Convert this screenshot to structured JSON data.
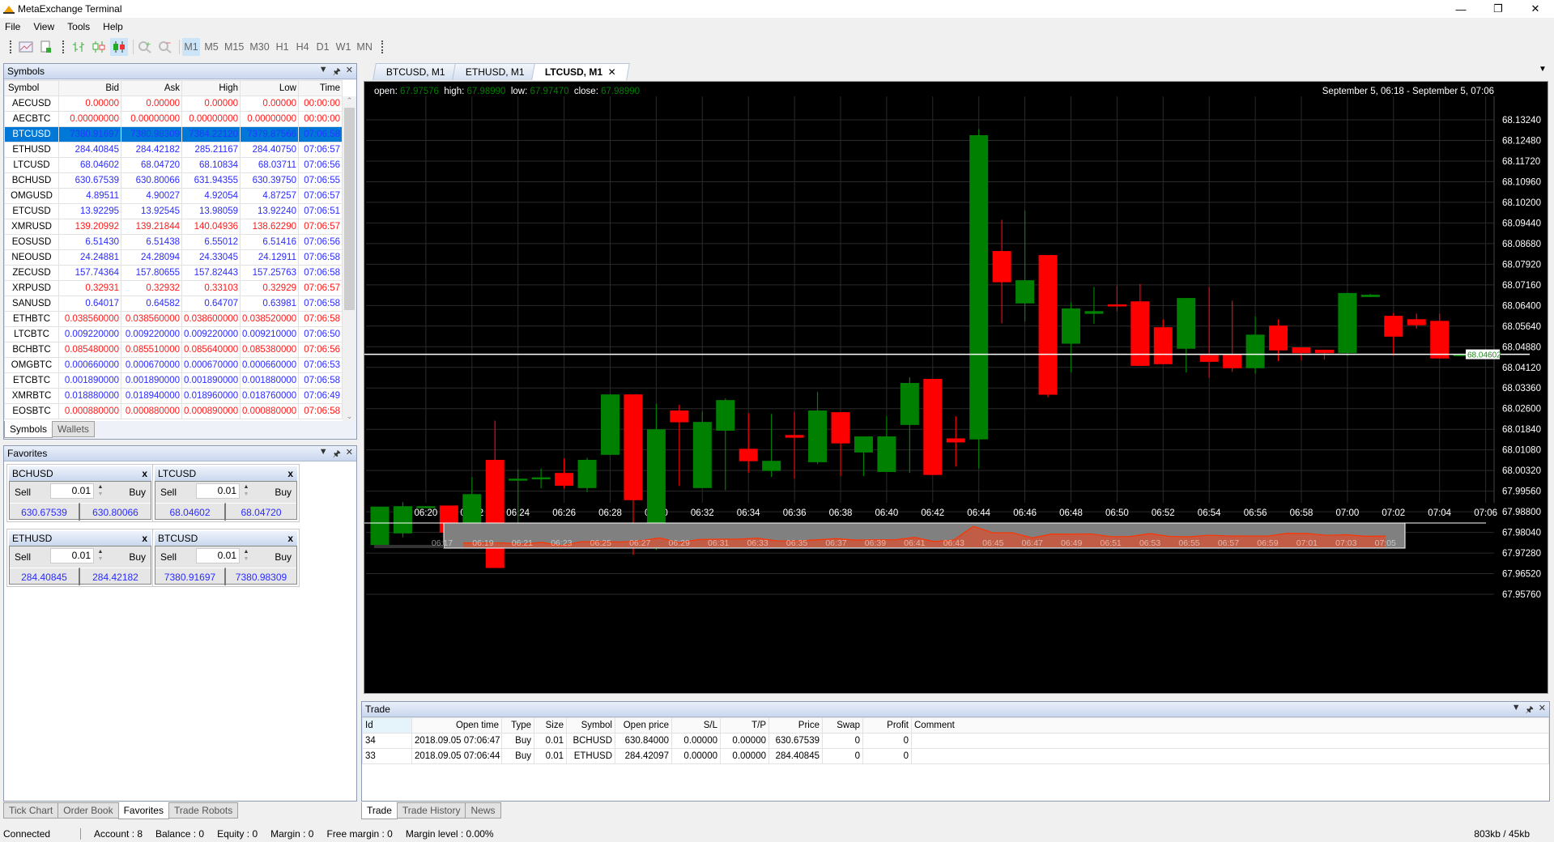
{
  "window": {
    "title": "MetaExchange Terminal"
  },
  "menu": [
    "File",
    "View",
    "Tools",
    "Help"
  ],
  "toolbar": {
    "timeframes": [
      "M1",
      "M5",
      "M15",
      "M30",
      "H1",
      "H4",
      "D1",
      "W1",
      "MN"
    ],
    "selected": "M1"
  },
  "symbols_panel": {
    "title": "Symbols",
    "columns": [
      "Symbol",
      "Bid",
      "Ask",
      "High",
      "Low",
      "Time"
    ],
    "rows": [
      [
        "AECUSD",
        "0.00000",
        "0.00000",
        "0.00000",
        "0.00000",
        "00:00:00",
        "down"
      ],
      [
        "AECBTC",
        "0.00000000",
        "0.00000000",
        "0.00000000",
        "0.00000000",
        "00:00:00",
        "down"
      ],
      [
        "BTCUSD",
        "7380.91697",
        "7380.98309",
        "7384.22120",
        "7379.87566",
        "07:06:58",
        "sel"
      ],
      [
        "ETHUSD",
        "284.40845",
        "284.42182",
        "285.21167",
        "284.40750",
        "07:06:57",
        "up"
      ],
      [
        "LTCUSD",
        "68.04602",
        "68.04720",
        "68.10834",
        "68.03711",
        "07:06:56",
        "up"
      ],
      [
        "BCHUSD",
        "630.67539",
        "630.80066",
        "631.94355",
        "630.39750",
        "07:06:55",
        "up"
      ],
      [
        "OMGUSD",
        "4.89511",
        "4.90027",
        "4.92054",
        "4.87257",
        "07:06:57",
        "up"
      ],
      [
        "ETCUSD",
        "13.92295",
        "13.92545",
        "13.98059",
        "13.92240",
        "07:06:51",
        "up"
      ],
      [
        "XMRUSD",
        "139.20992",
        "139.21844",
        "140.04936",
        "138.62290",
        "07:06:57",
        "down"
      ],
      [
        "EOSUSD",
        "6.51430",
        "6.51438",
        "6.55012",
        "6.51416",
        "07:06:56",
        "up"
      ],
      [
        "NEOUSD",
        "24.24881",
        "24.28094",
        "24.33045",
        "24.12911",
        "07:06:58",
        "up"
      ],
      [
        "ZECUSD",
        "157.74364",
        "157.80655",
        "157.82443",
        "157.25763",
        "07:06:58",
        "up"
      ],
      [
        "XRPUSD",
        "0.32931",
        "0.32932",
        "0.33103",
        "0.32929",
        "07:06:57",
        "down"
      ],
      [
        "SANUSD",
        "0.64017",
        "0.64582",
        "0.64707",
        "0.63981",
        "07:06:58",
        "up"
      ],
      [
        "ETHBTC",
        "0.038560000",
        "0.038560000",
        "0.038600000",
        "0.038520000",
        "07:06:58",
        "down"
      ],
      [
        "LTCBTC",
        "0.009220000",
        "0.009220000",
        "0.009220000",
        "0.009210000",
        "07:06:50",
        "up"
      ],
      [
        "BCHBTC",
        "0.085480000",
        "0.085510000",
        "0.085640000",
        "0.085380000",
        "07:06:56",
        "down"
      ],
      [
        "OMGBTC",
        "0.000660000",
        "0.000670000",
        "0.000670000",
        "0.000660000",
        "07:06:53",
        "up"
      ],
      [
        "ETCBTC",
        "0.001890000",
        "0.001890000",
        "0.001890000",
        "0.001880000",
        "07:06:58",
        "up"
      ],
      [
        "XMRBTC",
        "0.018880000",
        "0.018940000",
        "0.018960000",
        "0.018760000",
        "07:06:49",
        "up"
      ],
      [
        "EOSBTC",
        "0.000880000",
        "0.000880000",
        "0.000890000",
        "0.000880000",
        "07:06:58",
        "down"
      ]
    ],
    "tabs": [
      "Symbols",
      "Wallets"
    ]
  },
  "favorites_panel": {
    "title": "Favorites",
    "sell_label": "Sell",
    "buy_label": "Buy",
    "cards": [
      {
        "symbol": "BCHUSD",
        "qty": "0.01",
        "bid": "630.67539",
        "ask": "630.80066"
      },
      {
        "symbol": "LTCUSD",
        "qty": "0.01",
        "bid": "68.04602",
        "ask": "68.04720"
      },
      {
        "symbol": "ETHUSD",
        "qty": "0.01",
        "bid": "284.40845",
        "ask": "284.42182"
      },
      {
        "symbol": "BTCUSD",
        "qty": "0.01",
        "bid": "7380.91697",
        "ask": "7380.98309"
      }
    ]
  },
  "left_tabs": [
    "Tick Chart",
    "Order Book",
    "Favorites",
    "Trade Robots"
  ],
  "left_tabs_active": "Favorites",
  "chart_tabs": [
    "BTCUSD, M1",
    "ETHUSD, M1",
    "LTCUSD, M1"
  ],
  "chart_tab_active": "LTCUSD, M1",
  "chart": {
    "ohlc": {
      "open_label": "open:",
      "open": "67.97576",
      "high_label": "high:",
      "high": "67.98990",
      "low_label": "low:",
      "low": "67.97470",
      "close_label": "close:",
      "close": "67.98990"
    },
    "range": "September 5, 06:18 - September 5, 07:06",
    "current_price": "68.04602",
    "colors": {
      "up": "#008000",
      "down": "#ff0000",
      "nav_fill": "#c8593f",
      "nav_line": "#ff3300"
    }
  },
  "chart_data": {
    "type": "candlestick",
    "title": "LTCUSD, M1",
    "price_ticks": [
      "68.13240",
      "68.12480",
      "68.11720",
      "68.10960",
      "68.10200",
      "68.09440",
      "68.08680",
      "68.07920",
      "68.07160",
      "68.06400",
      "68.05640",
      "68.04880",
      "68.04120",
      "68.03360",
      "68.02600",
      "68.01840",
      "68.01080",
      "68.00320",
      "67.99560",
      "67.98800",
      "67.98040",
      "67.97280",
      "67.96520",
      "67.95760"
    ],
    "ylim": [
      67.9576,
      68.1324
    ],
    "time_ticks": [
      "06:20",
      "06:22",
      "06:24",
      "06:26",
      "06:28",
      "06:30",
      "06:32",
      "06:34",
      "06:36",
      "06:38",
      "06:40",
      "06:42",
      "06:44",
      "06:46",
      "06:48",
      "06:50",
      "06:52",
      "06:54",
      "06:56",
      "06:58",
      "07:00",
      "07:02",
      "07:04",
      "07:06"
    ],
    "navigator_ticks": [
      "06:17",
      "06:19",
      "06:21",
      "06:23",
      "06:25",
      "06:27",
      "06:29",
      "06:31",
      "06:33",
      "06:35",
      "06:37",
      "06:39",
      "06:41",
      "06:43",
      "06:45",
      "06:47",
      "06:49",
      "06:51",
      "06:53",
      "06:55",
      "06:57",
      "06:59",
      "07:01",
      "07:03",
      "07:05"
    ],
    "first_candle": "06:18",
    "candles": [
      [
        67.97576,
        67.9899,
        67.9747,
        67.9899
      ],
      [
        67.98004,
        67.99154,
        67.97855,
        67.99006
      ],
      [
        67.99,
        67.9901,
        67.99,
        67.99006
      ],
      [
        67.9903,
        67.9903,
        67.97608,
        67.98029
      ],
      [
        67.97917,
        68.00082,
        67.97917,
        67.99451
      ],
      [
        68.00713,
        68.0216,
        67.96729,
        67.96729
      ],
      [
        68.0001,
        68.00366,
        67.9783,
        68.0002
      ],
      [
        68.0006,
        68.00391,
        67.99661,
        68.00069
      ],
      [
        68.0023,
        68.00762,
        67.99661,
        67.9976
      ],
      [
        67.99674,
        68.00787,
        67.99525,
        68.00713
      ],
      [
        68.00898,
        68.03124,
        68.00898,
        68.03124
      ],
      [
        68.03124,
        68.03124,
        67.97212,
        67.99228
      ],
      [
        67.97743,
        68.02778,
        67.97397,
        68.01838
      ],
      [
        68.02531,
        68.02741,
        67.99748,
        68.02098
      ],
      [
        67.99674,
        68.02494,
        67.99674,
        68.0211
      ],
      [
        68.01788,
        68.02976,
        67.996,
        68.02914
      ],
      [
        68.01121,
        68.02432,
        68.00242,
        68.00663
      ],
      [
        68.00304,
        68.02407,
        68.00082,
        68.00676
      ],
      [
        68.01628,
        68.02469,
        68.0002,
        68.01529
      ],
      [
        68.00626,
        68.03211,
        68.00552,
        68.02531
      ],
      [
        68.02469,
        68.02469,
        68.00119,
        68.01319
      ],
      [
        68.00985,
        68.01578,
        68.00119,
        68.01578
      ],
      [
        68.00267,
        68.02321,
        68.00267,
        68.01578
      ],
      [
        68.01999,
        68.03755,
        68.0023,
        68.03545
      ],
      [
        68.03694,
        68.03694,
        68.00156,
        68.00156
      ],
      [
        68.01504,
        68.02321,
        68.00465,
        68.01356
      ],
      [
        68.01467,
        68.12897,
        68.00391,
        68.12674
      ],
      [
        68.08406,
        68.09557,
        68.05747,
        68.07256
      ],
      [
        68.06477,
        68.09891,
        68.05809,
        68.0733
      ],
      [
        68.08258,
        68.08258,
        68.03026,
        68.03112
      ],
      [
        68.04992,
        68.06526,
        68.03928,
        68.06291
      ],
      [
        68.06093,
        68.07083,
        68.05722,
        68.06192
      ],
      [
        68.0644,
        68.07132,
        68.0618,
        68.0642
      ],
      [
        68.06551,
        68.07194,
        68.04176,
        68.04176
      ],
      [
        68.05598,
        68.05883,
        68.04238,
        68.04238
      ],
      [
        68.04807,
        68.06675,
        68.03928,
        68.06675
      ],
      [
        68.04572,
        68.07083,
        68.03731,
        68.04324
      ],
      [
        68.04584,
        68.06576,
        68.03953,
        68.04089
      ],
      [
        68.04089,
        68.05994,
        68.03891,
        68.05326
      ],
      [
        68.0566,
        68.05883,
        68.04349,
        68.04745
      ],
      [
        68.04856,
        68.04856,
        68.04374,
        68.04646
      ],
      [
        68.0477,
        68.0477,
        68.04411,
        68.04646
      ],
      [
        68.04646,
        68.0686,
        68.04535,
        68.0686
      ],
      [
        68.06712,
        68.06823,
        68.06712,
        68.06798
      ],
      [
        68.06019,
        68.06118,
        68.04547,
        68.05252
      ],
      [
        68.05895,
        68.06106,
        68.05549,
        68.05673
      ],
      [
        68.05833,
        68.06106,
        68.04448,
        68.04448
      ],
      [
        68.046,
        68.0461,
        68.046,
        68.04602
      ]
    ]
  },
  "trade_panel": {
    "title": "Trade",
    "columns": [
      "Id",
      "Open time",
      "Type",
      "Size",
      "Symbol",
      "Open price",
      "S/L",
      "T/P",
      "Price",
      "Swap",
      "Profit",
      "Comment"
    ],
    "rows": [
      [
        "34",
        "2018.09.05 07:06:47",
        "Buy",
        "0.01",
        "BCHUSD",
        "630.84000",
        "0.00000",
        "0.00000",
        "630.67539",
        "0",
        "0",
        ""
      ],
      [
        "33",
        "2018.09.05 07:06:44",
        "Buy",
        "0.01",
        "ETHUSD",
        "284.42097",
        "0.00000",
        "0.00000",
        "284.40845",
        "0",
        "0",
        ""
      ]
    ],
    "tabs": [
      "Trade",
      "Trade History",
      "News"
    ],
    "active_tab": "Trade"
  },
  "status": {
    "connection": "Connected",
    "account": "Account : 8",
    "balance": "Balance : 0",
    "equity": "Equity : 0",
    "margin": "Margin : 0",
    "free_margin": "Free margin : 0",
    "margin_level": "Margin level : 0.00%",
    "traffic": "803kb / 45kb"
  }
}
